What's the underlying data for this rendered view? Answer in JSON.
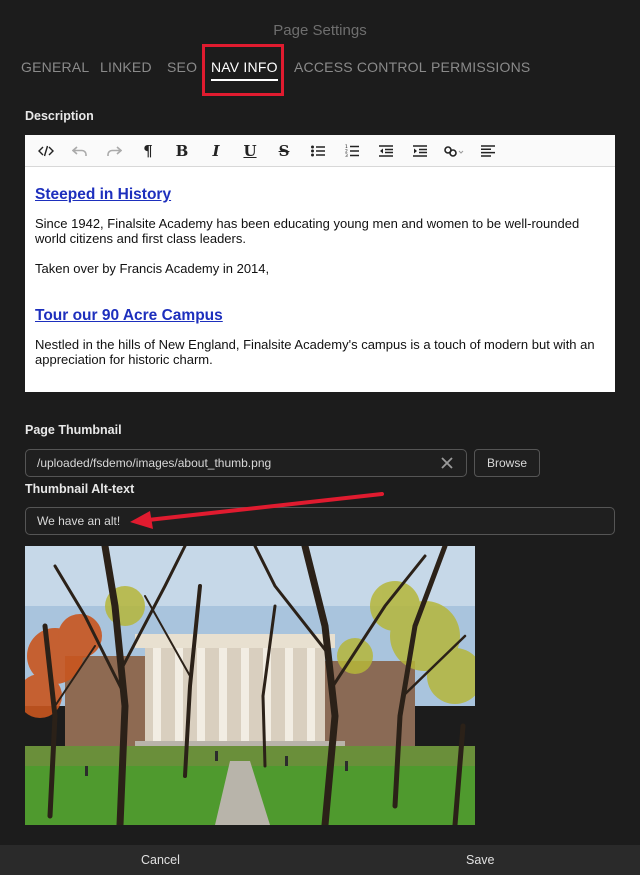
{
  "dialog": {
    "title": "Page Settings"
  },
  "tabs": [
    {
      "label": "GENERAL"
    },
    {
      "label": "LINKED"
    },
    {
      "label": "SEO"
    },
    {
      "label": "NAV INFO",
      "active": true
    },
    {
      "label": "ACCESS CONTROL"
    },
    {
      "label": "PERMISSIONS"
    }
  ],
  "description": {
    "label": "Description",
    "toolbar": [
      "code-view-icon",
      "undo-icon",
      "redo-icon",
      "paragraph-icon",
      "bold-icon",
      "italic-icon",
      "underline-icon",
      "strikethrough-icon",
      "bullet-list-icon",
      "numbered-list-icon",
      "outdent-icon",
      "indent-icon",
      "link-icon",
      "align-icon"
    ],
    "heading1": "Steeped in History",
    "para1": "Since 1942, Finalsite Academy has been educating young men and women to be well-rounded world citizens and first class leaders.",
    "para2": "Taken over by Francis Academy in 2014,",
    "heading2": "Tour our 90 Acre Campus",
    "para3": "Nestled in the hills of New England, Finalsite Academy's campus is a touch of modern but with an appreciation for historic charm."
  },
  "thumbnail": {
    "label": "Page Thumbnail",
    "path": "/uploaded/fsdemo/images/about_thumb.png",
    "browse_label": "Browse"
  },
  "alt_text": {
    "label": "Thumbnail Alt-text",
    "value": "We have an alt!"
  },
  "footer": {
    "cancel_label": "Cancel",
    "save_label": "Save"
  },
  "colors": {
    "highlight": "#e01b2f",
    "link": "#1d2fbd",
    "background": "#1c1c1c"
  }
}
